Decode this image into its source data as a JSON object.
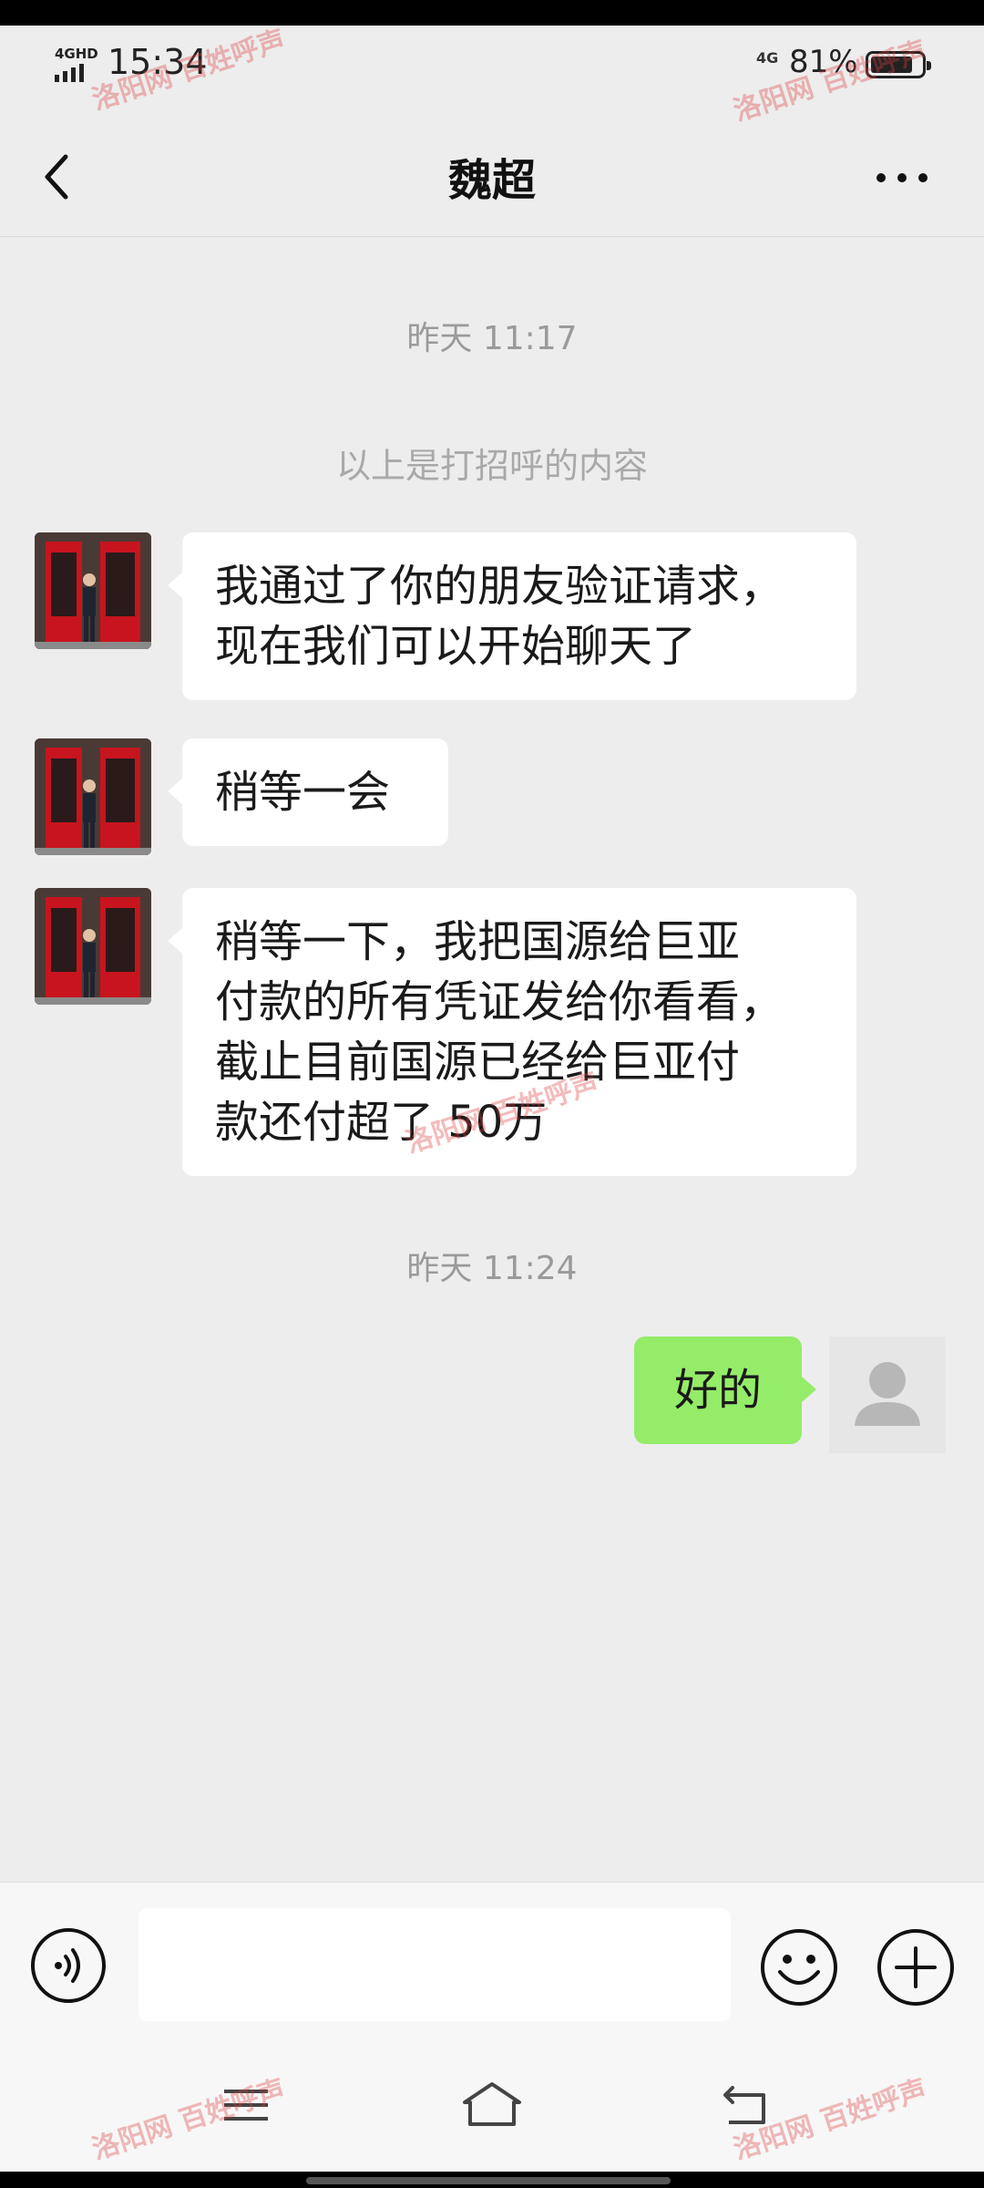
{
  "status_bar": {
    "network_label": "4GHD",
    "time": "15:34",
    "cell_label": "4G",
    "battery_percent": "81%",
    "battery_level": 0.81
  },
  "header": {
    "title": "魏超",
    "back_icon": "chevron-left-icon",
    "more_icon": "more-horizontal-icon"
  },
  "chat": {
    "timestamp_1": "昨天 11:17",
    "system_message": "以上是打招呼的内容",
    "messages": [
      {
        "side": "left",
        "lines": [
          "我通过了你的朋友验证请求，",
          "现在我们可以开始聊天了"
        ]
      },
      {
        "side": "left",
        "lines": [
          "稍等一会"
        ]
      },
      {
        "side": "left",
        "lines": [
          "稍等一下，我把国源给巨亚",
          "付款的所有凭证发给你看看，",
          "截止目前国源已经给巨亚付",
          "款还付超了 50万"
        ]
      }
    ],
    "timestamp_2": "昨天 11:24",
    "reply": {
      "side": "right",
      "text": "好的"
    }
  },
  "input_bar": {
    "voice_icon": "voice-icon",
    "input_value": "",
    "emoji_icon": "emoji-icon",
    "plus_icon": "plus-circle-icon"
  },
  "nav_bar": {
    "menu_icon": "menu-icon",
    "home_icon": "home-icon",
    "back_icon": "back-icon"
  },
  "watermark": "洛阳网 百姓呼声",
  "colors": {
    "background": "#ededed",
    "bubble_self": "#95ec69",
    "bubble_other": "#ffffff",
    "watermark": "#dc3c3c"
  }
}
